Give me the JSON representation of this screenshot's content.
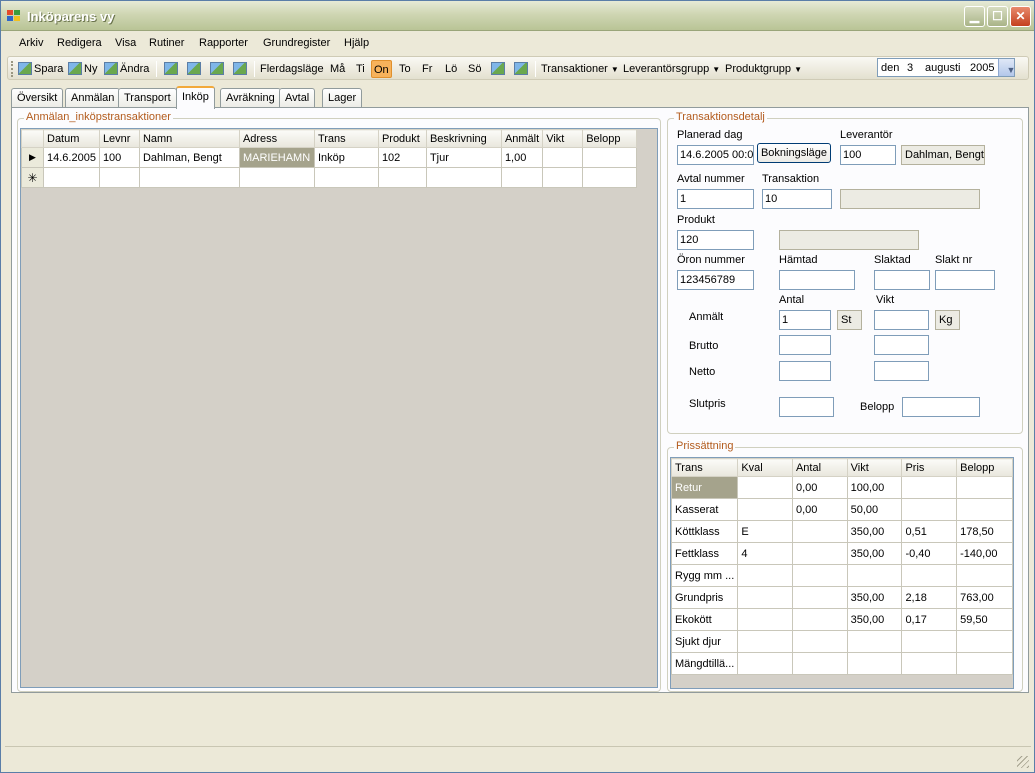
{
  "window": {
    "title": "Inköparens vy"
  },
  "menu": [
    "Arkiv",
    "Redigera",
    "Visa",
    "Rutiner",
    "Rapporter",
    "Grundregister",
    "Hjälp"
  ],
  "toolbar": {
    "save": "Spara",
    "new": "Ny",
    "edit": "Ändra",
    "multiday": "Flerdagsläge",
    "days": [
      "Må",
      "Ti",
      "On",
      "To",
      "Fr",
      "Lö",
      "Sö"
    ],
    "active_day": "On",
    "dropdowns": [
      "Transaktioner",
      "Leverantörsgrupp",
      "Produktgrupp"
    ],
    "date": {
      "prefix": "den",
      "day": "3",
      "month": "augusti",
      "year": "2005"
    }
  },
  "tabs": [
    "Översikt",
    "Anmälan",
    "Transport",
    "Inköp",
    "Avräkning",
    "Avtal",
    "Lager"
  ],
  "selected_tab": "Inköp",
  "left_group": {
    "title": "Anmälan_inköpstransaktioner",
    "columns": [
      "Datum",
      "Levnr",
      "Namn",
      "Adress",
      "Trans",
      "Produkt",
      "Beskrivning",
      "Anmält",
      "Vikt",
      "Belopp"
    ],
    "rows": [
      [
        "14.6.2005",
        "100",
        "Dahlman, Bengt",
        "MARIEHAMN",
        "Inköp",
        "102",
        "Tjur",
        "1,00",
        "",
        ""
      ]
    ]
  },
  "detail": {
    "title": "Transaktionsdetalj",
    "planerad_dag_label": "Planerad dag",
    "planerad_dag": "14.6.2005 00:0",
    "bokning_button": "Bokningsläge",
    "leverantor_label": "Leverantör",
    "leverantor": "100",
    "leverantor_name": "Dahlman, Bengt",
    "avtal_label": "Avtal nummer",
    "avtal": "1",
    "transaktion_label": "Transaktion",
    "transaktion": "10",
    "produkt_label": "Produkt",
    "produkt": "120",
    "oron_label": "Öron nummer",
    "oron": "123456789",
    "hamtad_label": "Hämtad",
    "slaktad_label": "Slaktad",
    "slakt_nr_label": "Slakt nr",
    "antal_label": "Antal",
    "vikt_label": "Vikt",
    "anmalt_label": "Anmält",
    "anmalt_antal": "1",
    "unit_st": "St",
    "unit_kg": "Kg",
    "brutto_label": "Brutto",
    "netto_label": "Netto",
    "slutpris_label": "Slutpris",
    "belopp_label": "Belopp"
  },
  "pricing": {
    "title": "Prissättning",
    "columns": [
      "Trans",
      "Kval",
      "Antal",
      "Vikt",
      "Pris",
      "Belopp"
    ],
    "rows": [
      [
        "Retur",
        "",
        "0,00",
        "100,00",
        "",
        ""
      ],
      [
        "Kasserat",
        "",
        "0,00",
        "50,00",
        "",
        ""
      ],
      [
        "Köttklass",
        "E",
        "",
        "350,00",
        "0,51",
        "178,50"
      ],
      [
        "Fettklass",
        "4",
        "",
        "350,00",
        "-0,40",
        "-140,00"
      ],
      [
        "Rygg mm ...",
        "",
        "",
        "",
        "",
        ""
      ],
      [
        "Grundpris",
        "",
        "",
        "350,00",
        "2,18",
        "763,00"
      ],
      [
        "Ekokött",
        "",
        "",
        "350,00",
        "0,17",
        "59,50"
      ],
      [
        "Sjukt djur",
        "",
        "",
        "",
        "",
        ""
      ],
      [
        "Mängdtillä...",
        "",
        "",
        "",
        "",
        ""
      ]
    ]
  }
}
